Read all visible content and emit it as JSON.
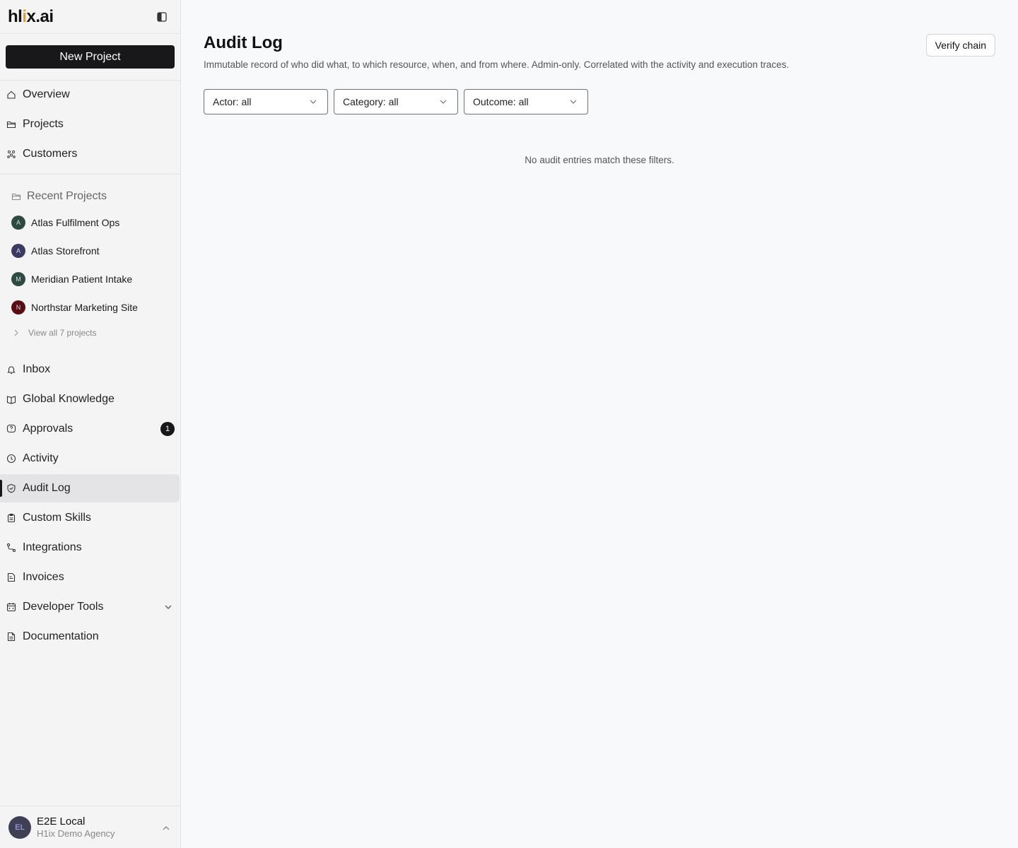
{
  "app": {
    "logo_pre": "hl",
    "logo_i": "i",
    "logo_post": "x.ai"
  },
  "sidebar": {
    "new_project": "New Project",
    "top_nav": [
      {
        "label": "Overview",
        "icon": "home-icon"
      },
      {
        "label": "Projects",
        "icon": "folder-icon"
      },
      {
        "label": "Customers",
        "icon": "users-icon"
      }
    ],
    "recent": {
      "heading": "Recent Projects",
      "projects": [
        {
          "label": "Atlas Fulfilment Ops",
          "initial": "A",
          "color": "#2d4a3e"
        },
        {
          "label": "Atlas Storefront",
          "initial": "A",
          "color": "#3c3a62"
        },
        {
          "label": "Meridian Patient Intake",
          "initial": "M",
          "color": "#2f4a3e"
        },
        {
          "label": "Northstar Marketing Site",
          "initial": "N",
          "color": "#5a0e14"
        }
      ],
      "view_all": "View all 7 projects"
    },
    "bottom_nav": [
      {
        "label": "Inbox",
        "icon": "bell-icon"
      },
      {
        "label": "Global Knowledge",
        "icon": "book-icon"
      },
      {
        "label": "Approvals",
        "icon": "help-bubble-icon",
        "badge": "1"
      },
      {
        "label": "Activity",
        "icon": "clock-icon"
      },
      {
        "label": "Audit Log",
        "icon": "shield-check-icon",
        "active": true
      },
      {
        "label": "Custom Skills",
        "icon": "clipboard-icon"
      },
      {
        "label": "Integrations",
        "icon": "route-icon"
      },
      {
        "label": "Invoices",
        "icon": "invoice-icon"
      },
      {
        "label": "Developer Tools",
        "icon": "calendar-code-icon",
        "expandable": true
      },
      {
        "label": "Documentation",
        "icon": "document-icon"
      }
    ],
    "user": {
      "initials": "EL",
      "name": "E2E Local",
      "org": "H1ix Demo Agency"
    }
  },
  "main": {
    "title": "Audit Log",
    "subtitle": "Immutable record of who did what, to which resource, when, and from where. Admin-only. Correlated with the activity and execution traces.",
    "verify_button": "Verify chain",
    "filters": [
      {
        "label": "Actor: all"
      },
      {
        "label": "Category: all"
      },
      {
        "label": "Outcome: all"
      }
    ],
    "empty_state": "No audit entries match these filters."
  }
}
